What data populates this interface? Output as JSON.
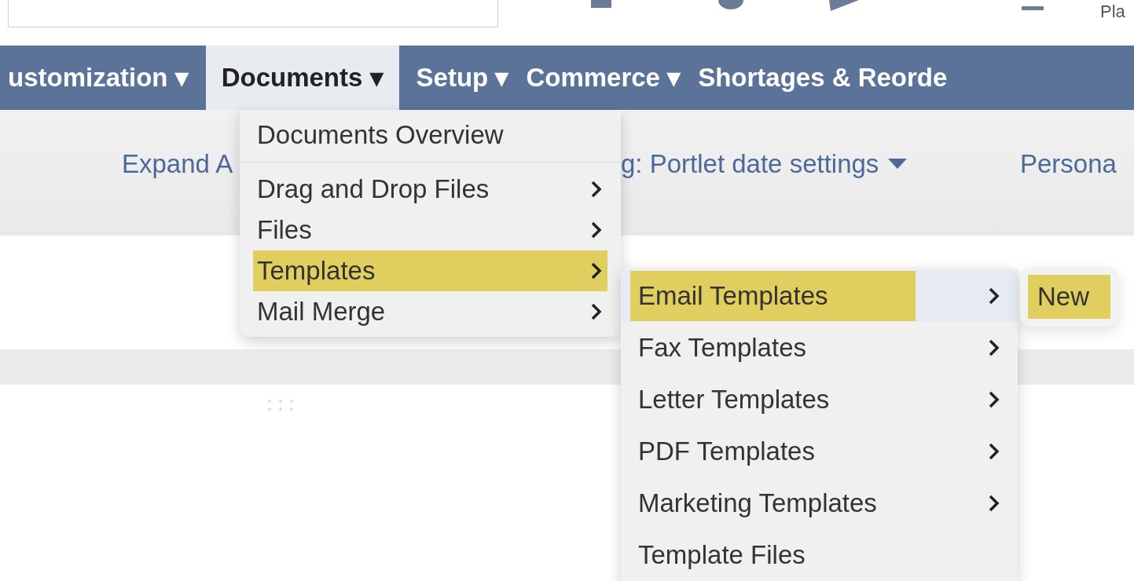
{
  "top_bar": {
    "label_partial": "Pla"
  },
  "nav": [
    {
      "label": "ustomization ▾",
      "selected": false
    },
    {
      "label": "Documents ▾",
      "selected": true
    },
    {
      "label": "Setup ▾",
      "selected": false
    },
    {
      "label": "Commerce ▾",
      "selected": false
    },
    {
      "label": "Shortages & Reorde",
      "selected": false
    }
  ],
  "toolbar": {
    "expand": "Expand A",
    "settings": "g: Portlet date settings",
    "personalize": "Persona"
  },
  "menu": [
    {
      "label": "Documents Overview",
      "submenu": false,
      "selected": false
    },
    {
      "label": "Drag and Drop Files",
      "submenu": true,
      "selected": false
    },
    {
      "label": "Files",
      "submenu": true,
      "selected": false
    },
    {
      "label": "Templates",
      "submenu": true,
      "selected": true
    },
    {
      "label": "Mail Merge",
      "submenu": true,
      "selected": false
    }
  ],
  "submenu": [
    {
      "label": "Email Templates",
      "submenu": true,
      "selected": true
    },
    {
      "label": "Fax Templates",
      "submenu": true,
      "selected": false
    },
    {
      "label": "Letter Templates",
      "submenu": true,
      "selected": false
    },
    {
      "label": "PDF Templates",
      "submenu": true,
      "selected": false
    },
    {
      "label": "Marketing Templates",
      "submenu": true,
      "selected": false
    },
    {
      "label": "Template Files",
      "submenu": false,
      "selected": false
    }
  ],
  "subsubmenu": [
    {
      "label": "New",
      "selected": true
    }
  ]
}
